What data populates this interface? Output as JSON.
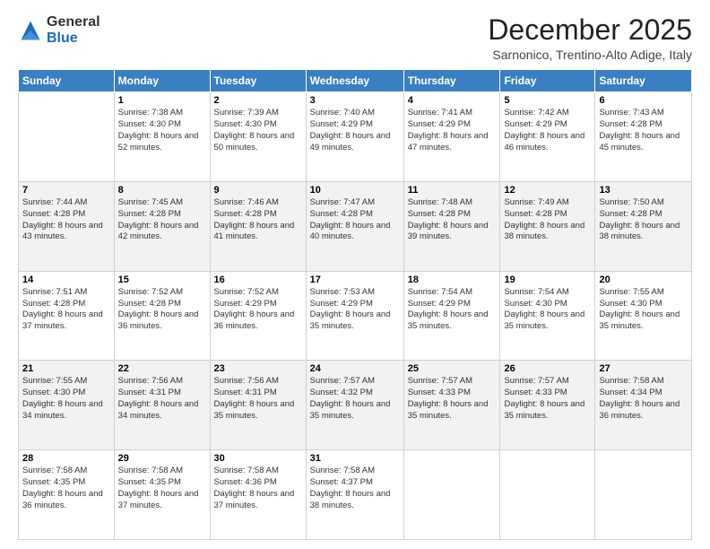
{
  "header": {
    "logo_general": "General",
    "logo_blue": "Blue",
    "month_title": "December 2025",
    "location": "Sarnonico, Trentino-Alto Adige, Italy"
  },
  "weekdays": [
    "Sunday",
    "Monday",
    "Tuesday",
    "Wednesday",
    "Thursday",
    "Friday",
    "Saturday"
  ],
  "weeks": [
    [
      {
        "day": "",
        "sunrise": "",
        "sunset": "",
        "daylight": ""
      },
      {
        "day": "1",
        "sunrise": "Sunrise: 7:38 AM",
        "sunset": "Sunset: 4:30 PM",
        "daylight": "Daylight: 8 hours and 52 minutes."
      },
      {
        "day": "2",
        "sunrise": "Sunrise: 7:39 AM",
        "sunset": "Sunset: 4:30 PM",
        "daylight": "Daylight: 8 hours and 50 minutes."
      },
      {
        "day": "3",
        "sunrise": "Sunrise: 7:40 AM",
        "sunset": "Sunset: 4:29 PM",
        "daylight": "Daylight: 8 hours and 49 minutes."
      },
      {
        "day": "4",
        "sunrise": "Sunrise: 7:41 AM",
        "sunset": "Sunset: 4:29 PM",
        "daylight": "Daylight: 8 hours and 47 minutes."
      },
      {
        "day": "5",
        "sunrise": "Sunrise: 7:42 AM",
        "sunset": "Sunset: 4:29 PM",
        "daylight": "Daylight: 8 hours and 46 minutes."
      },
      {
        "day": "6",
        "sunrise": "Sunrise: 7:43 AM",
        "sunset": "Sunset: 4:28 PM",
        "daylight": "Daylight: 8 hours and 45 minutes."
      }
    ],
    [
      {
        "day": "7",
        "sunrise": "Sunrise: 7:44 AM",
        "sunset": "Sunset: 4:28 PM",
        "daylight": "Daylight: 8 hours and 43 minutes."
      },
      {
        "day": "8",
        "sunrise": "Sunrise: 7:45 AM",
        "sunset": "Sunset: 4:28 PM",
        "daylight": "Daylight: 8 hours and 42 minutes."
      },
      {
        "day": "9",
        "sunrise": "Sunrise: 7:46 AM",
        "sunset": "Sunset: 4:28 PM",
        "daylight": "Daylight: 8 hours and 41 minutes."
      },
      {
        "day": "10",
        "sunrise": "Sunrise: 7:47 AM",
        "sunset": "Sunset: 4:28 PM",
        "daylight": "Daylight: 8 hours and 40 minutes."
      },
      {
        "day": "11",
        "sunrise": "Sunrise: 7:48 AM",
        "sunset": "Sunset: 4:28 PM",
        "daylight": "Daylight: 8 hours and 39 minutes."
      },
      {
        "day": "12",
        "sunrise": "Sunrise: 7:49 AM",
        "sunset": "Sunset: 4:28 PM",
        "daylight": "Daylight: 8 hours and 38 minutes."
      },
      {
        "day": "13",
        "sunrise": "Sunrise: 7:50 AM",
        "sunset": "Sunset: 4:28 PM",
        "daylight": "Daylight: 8 hours and 38 minutes."
      }
    ],
    [
      {
        "day": "14",
        "sunrise": "Sunrise: 7:51 AM",
        "sunset": "Sunset: 4:28 PM",
        "daylight": "Daylight: 8 hours and 37 minutes."
      },
      {
        "day": "15",
        "sunrise": "Sunrise: 7:52 AM",
        "sunset": "Sunset: 4:28 PM",
        "daylight": "Daylight: 8 hours and 36 minutes."
      },
      {
        "day": "16",
        "sunrise": "Sunrise: 7:52 AM",
        "sunset": "Sunset: 4:29 PM",
        "daylight": "Daylight: 8 hours and 36 minutes."
      },
      {
        "day": "17",
        "sunrise": "Sunrise: 7:53 AM",
        "sunset": "Sunset: 4:29 PM",
        "daylight": "Daylight: 8 hours and 35 minutes."
      },
      {
        "day": "18",
        "sunrise": "Sunrise: 7:54 AM",
        "sunset": "Sunset: 4:29 PM",
        "daylight": "Daylight: 8 hours and 35 minutes."
      },
      {
        "day": "19",
        "sunrise": "Sunrise: 7:54 AM",
        "sunset": "Sunset: 4:30 PM",
        "daylight": "Daylight: 8 hours and 35 minutes."
      },
      {
        "day": "20",
        "sunrise": "Sunrise: 7:55 AM",
        "sunset": "Sunset: 4:30 PM",
        "daylight": "Daylight: 8 hours and 35 minutes."
      }
    ],
    [
      {
        "day": "21",
        "sunrise": "Sunrise: 7:55 AM",
        "sunset": "Sunset: 4:30 PM",
        "daylight": "Daylight: 8 hours and 34 minutes."
      },
      {
        "day": "22",
        "sunrise": "Sunrise: 7:56 AM",
        "sunset": "Sunset: 4:31 PM",
        "daylight": "Daylight: 8 hours and 34 minutes."
      },
      {
        "day": "23",
        "sunrise": "Sunrise: 7:56 AM",
        "sunset": "Sunset: 4:31 PM",
        "daylight": "Daylight: 8 hours and 35 minutes."
      },
      {
        "day": "24",
        "sunrise": "Sunrise: 7:57 AM",
        "sunset": "Sunset: 4:32 PM",
        "daylight": "Daylight: 8 hours and 35 minutes."
      },
      {
        "day": "25",
        "sunrise": "Sunrise: 7:57 AM",
        "sunset": "Sunset: 4:33 PM",
        "daylight": "Daylight: 8 hours and 35 minutes."
      },
      {
        "day": "26",
        "sunrise": "Sunrise: 7:57 AM",
        "sunset": "Sunset: 4:33 PM",
        "daylight": "Daylight: 8 hours and 35 minutes."
      },
      {
        "day": "27",
        "sunrise": "Sunrise: 7:58 AM",
        "sunset": "Sunset: 4:34 PM",
        "daylight": "Daylight: 8 hours and 36 minutes."
      }
    ],
    [
      {
        "day": "28",
        "sunrise": "Sunrise: 7:58 AM",
        "sunset": "Sunset: 4:35 PM",
        "daylight": "Daylight: 8 hours and 36 minutes."
      },
      {
        "day": "29",
        "sunrise": "Sunrise: 7:58 AM",
        "sunset": "Sunset: 4:35 PM",
        "daylight": "Daylight: 8 hours and 37 minutes."
      },
      {
        "day": "30",
        "sunrise": "Sunrise: 7:58 AM",
        "sunset": "Sunset: 4:36 PM",
        "daylight": "Daylight: 8 hours and 37 minutes."
      },
      {
        "day": "31",
        "sunrise": "Sunrise: 7:58 AM",
        "sunset": "Sunset: 4:37 PM",
        "daylight": "Daylight: 8 hours and 38 minutes."
      },
      {
        "day": "",
        "sunrise": "",
        "sunset": "",
        "daylight": ""
      },
      {
        "day": "",
        "sunrise": "",
        "sunset": "",
        "daylight": ""
      },
      {
        "day": "",
        "sunrise": "",
        "sunset": "",
        "daylight": ""
      }
    ]
  ]
}
